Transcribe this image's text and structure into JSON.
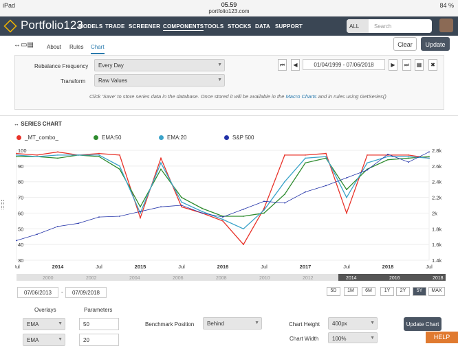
{
  "status": {
    "device": "iPad",
    "time": "05.59",
    "url": "portfolio123.com",
    "battery": "84 %"
  },
  "nav": {
    "brand": "Portfolio123",
    "items": [
      "MODELS",
      "TRADE",
      "SCREENER",
      "COMPONENTS",
      "TOOLS",
      "STOCKS",
      "DATA",
      "SUPPORT"
    ],
    "active": "COMPONENTS",
    "search_scope": "ALL",
    "search_placeholder": "Search"
  },
  "tabs": [
    "About",
    "Rules",
    "Chart"
  ],
  "active_tab": "Chart",
  "buttons": {
    "clear": "Clear",
    "update": "Update",
    "update_chart": "Update Chart",
    "help": "HELP"
  },
  "form": {
    "rebalance_label": "Rebalance Frequency",
    "rebalance_value": "Every Day",
    "transform_label": "Transform",
    "transform_value": "Raw Values",
    "date_range": "01/04/1999 - 07/06/2018",
    "note_pre": "Click 'Save' to store series data in the database. Once stored it will be available in the ",
    "note_link": "Macro Charts",
    "note_post": " and in rules using GetSeries()"
  },
  "series_title": "SERIES CHART",
  "legend": [
    {
      "name": "_MT_combo_",
      "color": "#e8332a"
    },
    {
      "name": "EMA:50",
      "color": "#2e8b2e"
    },
    {
      "name": "EMA:20",
      "color": "#3ba3c9"
    },
    {
      "name": "S&P 500",
      "color": "#2232a8"
    }
  ],
  "chart_data": {
    "type": "line",
    "x": [
      "2013-07",
      "2013-10",
      "2014-01",
      "2014-04",
      "2014-07",
      "2014-10",
      "2015-01",
      "2015-04",
      "2015-07",
      "2015-10",
      "2016-01",
      "2016-04",
      "2016-07",
      "2016-10",
      "2017-01",
      "2017-04",
      "2017-07",
      "2017-10",
      "2018-01",
      "2018-04",
      "2018-07"
    ],
    "series": [
      {
        "name": "_MT_combo_",
        "axis": "left",
        "values": [
          98,
          97,
          99,
          97,
          98,
          97,
          57,
          95,
          64,
          60,
          55,
          40,
          63,
          97,
          97,
          98,
          60,
          97,
          97,
          97,
          95
        ]
      },
      {
        "name": "EMA:50",
        "axis": "left",
        "values": [
          96,
          96,
          95,
          97,
          96,
          88,
          64,
          88,
          70,
          63,
          58,
          58,
          60,
          72,
          92,
          95,
          75,
          88,
          94,
          95,
          96
        ]
      },
      {
        "name": "EMA:20",
        "axis": "left",
        "values": [
          97,
          96,
          97,
          97,
          97,
          90,
          60,
          92,
          67,
          61,
          56,
          50,
          62,
          80,
          95,
          96,
          70,
          92,
          96,
          96,
          95
        ]
      },
      {
        "name": "S&P 500",
        "axis": "right",
        "values": [
          1.65,
          1.73,
          1.83,
          1.87,
          1.95,
          1.96,
          2.02,
          2.08,
          2.1,
          2.0,
          1.95,
          2.05,
          2.15,
          2.13,
          2.27,
          2.35,
          2.45,
          2.55,
          2.75,
          2.65,
          2.78
        ]
      }
    ],
    "left_ticks": [
      "100",
      "90",
      "80",
      "70",
      "60",
      "50",
      "40",
      "30"
    ],
    "left_range": [
      30,
      100
    ],
    "right_ticks": [
      "2.8k",
      "2.6k",
      "2.4k",
      "2.2k",
      "2k",
      "1.8k",
      "1.6k",
      "1.4k"
    ],
    "right_range": [
      1.4,
      2.8
    ],
    "x_ticks": [
      "Jul",
      "2014",
      "Jul",
      "2015",
      "Jul",
      "2016",
      "Jul",
      "2017",
      "Jul",
      "2018",
      "Jul"
    ],
    "nav_ticks": [
      "2000",
      "2002",
      "2004",
      "2006",
      "2008",
      "2010",
      "2012",
      "2014",
      "2016",
      "2018"
    ]
  },
  "range": {
    "from": "07/06/2013",
    "to": "07/09/2018"
  },
  "periods": [
    "5D",
    "1M",
    "6M",
    "1Y",
    "2Y",
    "5Y",
    "MAX"
  ],
  "active_period": "5Y",
  "bottom": {
    "overlays_label": "Overlays",
    "parameters_label": "Parameters",
    "overlays": [
      "EMA",
      "EMA"
    ],
    "params": [
      "50",
      "20"
    ],
    "benchmark_label": "Benchmark Position",
    "benchmark_value": "Behind",
    "height_label": "Chart Height",
    "height_value": "400px",
    "width_label": "Chart Width",
    "width_value": "100%"
  }
}
